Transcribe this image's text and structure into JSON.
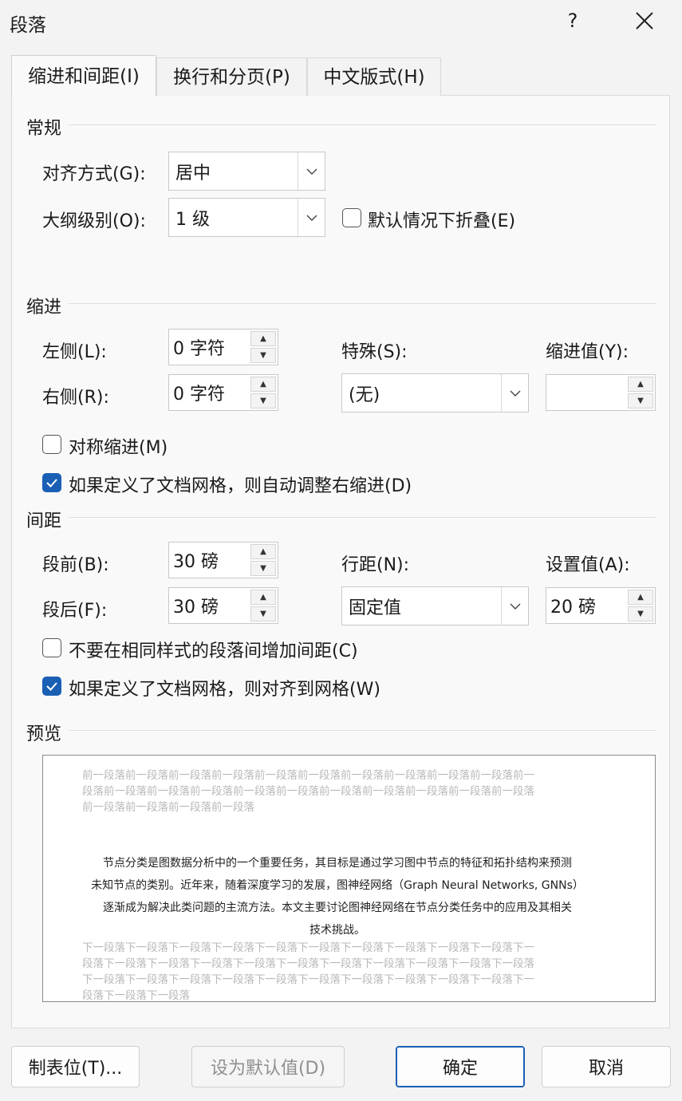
{
  "window": {
    "title": "段落",
    "help": "?"
  },
  "tabs": [
    {
      "label": "缩进和间距(I)"
    },
    {
      "label": "换行和分页(P)"
    },
    {
      "label": "中文版式(H)"
    }
  ],
  "general": {
    "title": "常规",
    "alignment_label": "对齐方式(G):",
    "alignment_value": "居中",
    "outline_label": "大纲级别(O):",
    "outline_value": "1 级",
    "collapse_label": "默认情况下折叠(E)",
    "collapse_checked": false
  },
  "indent": {
    "title": "缩进",
    "left_label": "左侧(L):",
    "left_value": "0 字符",
    "right_label": "右侧(R):",
    "right_value": "0 字符",
    "special_label": "特殊(S):",
    "special_value": "(无)",
    "indent_by_label": "缩进值(Y):",
    "indent_by_value": "",
    "mirror_label": "对称缩进(M)",
    "mirror_checked": false,
    "auto_adjust_label": "如果定义了文档网格，则自动调整右缩进(D)",
    "auto_adjust_checked": true
  },
  "spacing": {
    "title": "间距",
    "before_label": "段前(B):",
    "before_value": "30 磅",
    "after_label": "段后(F):",
    "after_value": "30 磅",
    "line_spacing_label": "行距(N):",
    "line_spacing_value": "固定值",
    "at_label": "设置值(A):",
    "at_value": "20 磅",
    "dont_add_label": "不要在相同样式的段落间增加间距(C)",
    "dont_add_checked": false,
    "snap_grid_label": "如果定义了文档网格，则对齐到网格(W)",
    "snap_grid_checked": true
  },
  "preview": {
    "title": "预览",
    "prev_lines": [
      "前一段落前一段落前一段落前一段落前一段落前一段落前一段落前一段落前一段落前一段落前一",
      "段落前一段落前一段落前一段落前一段落前一段落前一段落前一段落前一段落前一段落前一段落",
      "前一段落前一段落前一段落前一段落"
    ],
    "main_lines": [
      "节点分类是图数据分析中的一个重要任务，其目标是通过学习图中节点的特征和拓扑结构来预测",
      "未知节点的类别。近年来，随着深度学习的发展，图神经网络（Graph Neural Networks, GNNs）",
      "逐渐成为解决此类问题的主流方法。本文主要讨论图神经网络在节点分类任务中的应用及其相关",
      "技术挑战。"
    ],
    "next_lines": [
      "下一段落下一段落下一段落下一段落下一段落下一段落下一段落下一段落下一段落下一段落下一",
      "段落下一段落下一段落下一段落下一段落下一段落下一段落下一段落下一段落下一段落下一段落",
      "下一段落下一段落下一段落下一段落下一段落下一段落下一段落下一段落下一段落下一段落下一",
      "段落下一段落下一段落"
    ]
  },
  "footer": {
    "tabs_button": "制表位(T)...",
    "set_default_button": "设为默认值(D)",
    "ok_button": "确定",
    "cancel_button": "取消"
  },
  "colors": {
    "accent": "#1a5fb4",
    "background": "#f3f3f3",
    "panel": "#f9f9f9"
  }
}
